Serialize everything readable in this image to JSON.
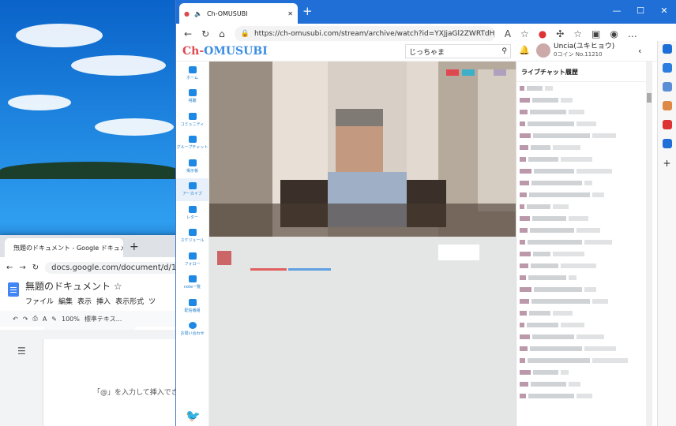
{
  "desktop": {
    "name": "desktop"
  },
  "docs": {
    "tab_title": "無題のドキュメント - Google ドキュメント",
    "url": "docs.google.com/document/d/1G",
    "doc_title": "無題のドキュメント",
    "menu": [
      "ファイル",
      "編集",
      "表示",
      "挿入",
      "表示形式",
      "ツ"
    ],
    "zoom": "100%",
    "style": "標準テキス...",
    "hint": "「@」を入力して挿入でき"
  },
  "edge": {
    "tab_title": "Ch-OMUSUBI",
    "url": "https://ch-omusubi.com/stream/archive/watch?id=YXJjaGl2ZWRTdHJlY",
    "site": {
      "logo_a": "Ch-",
      "logo_b": "OMUSUBI",
      "search_value": "じっちゃま",
      "user_name": "Uncia(ユキヒョウ)",
      "coins": "0コイン",
      "member_no": "No.11210",
      "chat_header": "ライブチャット履歴",
      "nav": [
        "ホーム",
        "視聴",
        "コミュニティ",
        "グループチャット",
        "掲示板",
        "アーカイブ",
        "レター",
        "スケジュール",
        "フォロー",
        "note一覧",
        "配信番組",
        "お問い合わせ"
      ]
    }
  }
}
